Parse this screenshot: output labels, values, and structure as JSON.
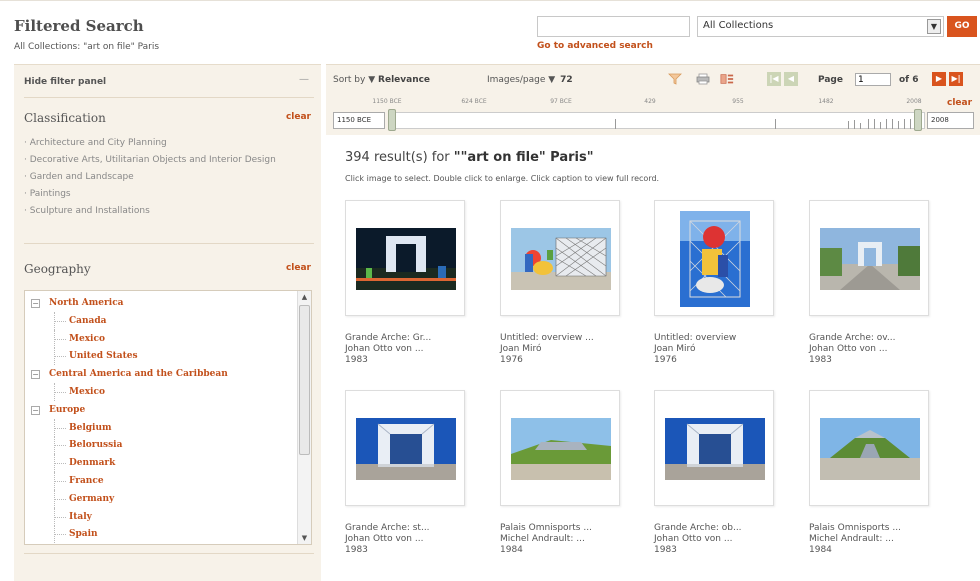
{
  "header": {
    "title": "Filtered Search",
    "subtitle": "All Collections: \"art on file\" Paris",
    "search_value": "",
    "collection_selected": "All Collections",
    "go_label": "GO",
    "advanced_link": "Go to advanced search"
  },
  "filter_panel": {
    "hide_label": "Hide filter panel",
    "collapse_symbol": "—",
    "classification_title": "Classification",
    "clear_label": "clear",
    "classifications": [
      "Architecture and City Planning",
      "Decorative Arts, Utilitarian Objects and Interior Design",
      "Garden and Landscape",
      "Paintings",
      "Sculpture and Installations"
    ],
    "geography_title": "Geography",
    "geography": [
      {
        "label": "North America",
        "level": 0
      },
      {
        "label": "Canada",
        "level": 1
      },
      {
        "label": "Mexico",
        "level": 1
      },
      {
        "label": "United States",
        "level": 1
      },
      {
        "label": "Central America and the Caribbean",
        "level": 0
      },
      {
        "label": "Mexico",
        "level": 1
      },
      {
        "label": "Europe",
        "level": 0
      },
      {
        "label": "Belgium",
        "level": 1
      },
      {
        "label": "Belorussia",
        "level": 1
      },
      {
        "label": "Denmark",
        "level": 1
      },
      {
        "label": "France",
        "level": 1
      },
      {
        "label": "Germany",
        "level": 1
      },
      {
        "label": "Italy",
        "level": 1
      },
      {
        "label": "Spain",
        "level": 1
      }
    ]
  },
  "toolbar": {
    "sort_label": "Sort by",
    "sort_value": "Relevance",
    "images_per_page_label": "Images/page",
    "images_per_page_value": "72",
    "page_label": "Page",
    "page_value": "1",
    "page_of": "of 6",
    "icons": [
      "filter-icon",
      "print-icon",
      "view-toggle-icon"
    ]
  },
  "timeline": {
    "labels": [
      "1150 BCE",
      "624 BCE",
      "97 BCE",
      "429",
      "955",
      "1482",
      "2008"
    ],
    "start_value": "1150 BCE",
    "end_value": "2008",
    "clear_label": "clear"
  },
  "results": {
    "count_text": "394 result(s) for",
    "query_text": "\"\"art on file\" Paris\"",
    "hint": "Click image to select. Double click to enlarge. Click caption to view full record."
  },
  "items": [
    {
      "title": "Grande Arche: Gr...",
      "artist": "Johan Otto von ...",
      "year": "1983",
      "scene": "arche-night"
    },
    {
      "title": "Untitled: overview ...",
      "artist": "Joan Miró",
      "year": "1976",
      "scene": "miro-wide"
    },
    {
      "title": "Untitled: overview",
      "artist": "Joan Miró",
      "year": "1976",
      "scene": "miro-tall"
    },
    {
      "title": "Grande Arche: ov...",
      "artist": "Johan Otto von ...",
      "year": "1983",
      "scene": "arche-avenue"
    },
    {
      "title": "Grande Arche: st...",
      "artist": "Johan Otto von ...",
      "year": "1983",
      "scene": "arche-blue"
    },
    {
      "title": "Palais Omnisports ...",
      "artist": "Michel Andrault: ...",
      "year": "1984",
      "scene": "palais-grass"
    },
    {
      "title": "Grande Arche: ob...",
      "artist": "Johan Otto von ...",
      "year": "1983",
      "scene": "arche-blue"
    },
    {
      "title": "Palais Omnisports ...",
      "artist": "Michel Andrault: ...",
      "year": "1984",
      "scene": "palais-sky"
    }
  ]
}
